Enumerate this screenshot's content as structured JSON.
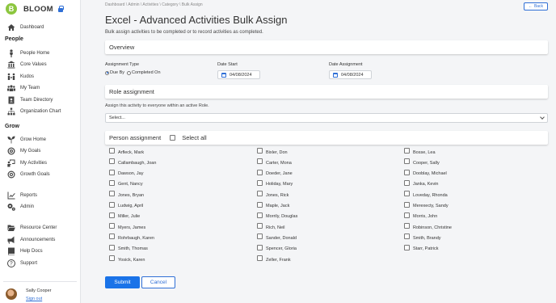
{
  "brand": {
    "name": "BLOOM",
    "logo_letter": "B"
  },
  "nav": {
    "dashboard": "Dashboard",
    "people_section": "People",
    "people_home": "People Home",
    "core_values": "Core Values",
    "kudos": "Kudos",
    "my_team": "My Team",
    "team_directory": "Team Directory",
    "org_chart": "Organization Chart",
    "grow_section": "Grow",
    "grow_home": "Grow Home",
    "my_goals": "My Goals",
    "my_activities": "My Activities",
    "growth_goals": "Growth Goals",
    "reports": "Reports",
    "admin": "Admin",
    "resource_center": "Resource Center",
    "announcements": "Announcements",
    "help_docs": "Help Docs",
    "support": "Support"
  },
  "user": {
    "name": "Sally Cooper",
    "sign_out": "Sign out"
  },
  "breadcrumb": "Dashboard \\ Admin \\ Activities \\ Category \\ Bulk Assign",
  "back_label": "Back",
  "page": {
    "title": "Excel - Advanced Activities Bulk Assign",
    "subtitle": "Bulk assign activities to be completed or to record activities as completed."
  },
  "overview": {
    "title": "Overview",
    "assignment_type_label": "Assignment Type",
    "due_by_label": "Due By",
    "completed_on_label": "Completed On",
    "selected_type": "due_by",
    "date_start_label": "Date Start",
    "date_start_value": "04/08/2024",
    "date_assignment_label": "Date Assignment",
    "date_assignment_value": "04/08/2024"
  },
  "role": {
    "title": "Role assignment",
    "helper": "Assign this activity to everyone within an active Role.",
    "select_value": "Select..."
  },
  "person": {
    "title": "Person assignment",
    "select_all_label": "Select all",
    "columns": [
      [
        "Arfleck, Mark",
        "Callambaugh, Joan",
        "Dawson, Jay",
        "Gent, Nancy",
        "Jones, Bryan",
        "Ludwig, April",
        "Miller, Julie",
        "Myers, James",
        "Rohrbaugh, Karen",
        "Smith, Thomas",
        "Yosick, Karen"
      ],
      [
        "Bixler, Don",
        "Carter, Mona",
        "Doeder, Jane",
        "Holiday, Mary",
        "Jones, Rick",
        "Maple, Jack",
        "Morrily, Douglas",
        "Rich, Neil",
        "Sander, Donald",
        "Spencer, Gloria",
        "Zeller, Frank"
      ],
      [
        "Bosse, Lea",
        "Cooper, Sally",
        "Dooblay, Michael",
        "Janka, Kevin",
        "Loveday, Rhonda",
        "Merexecty, Sandy",
        "Morris, John",
        "Robinson, Christine",
        "Smith, Brandy",
        "Starr, Patrick"
      ]
    ]
  },
  "actions": {
    "submit": "Submit",
    "cancel": "Cancel"
  }
}
